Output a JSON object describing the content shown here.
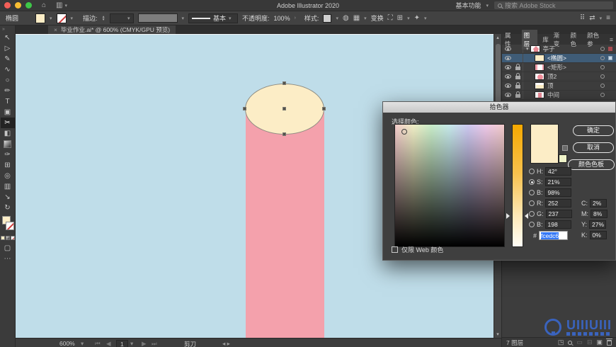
{
  "window": {
    "title": "Adobe Illustrator 2020",
    "workspace_switcher": "基本功能",
    "search_placeholder": "搜索 Adobe Stock"
  },
  "control_bar": {
    "context_label": "椭圆",
    "stroke_label": "描边:",
    "brush_label": "基本",
    "opacity_label": "不透明度:",
    "opacity_value": "100%",
    "style_label": "样式:",
    "transform_label": "变换"
  },
  "document_tab": {
    "close": "×",
    "title": "毕业作业.ai* @ 600% (CMYK/GPU 预览)"
  },
  "toolbar": {
    "tools": [
      {
        "name": "selection-tool",
        "glyph": "↖"
      },
      {
        "name": "direct-selection-tool",
        "glyph": "▷"
      },
      {
        "name": "pen-tool",
        "glyph": "✎"
      },
      {
        "name": "curvature-tool",
        "glyph": "∿"
      },
      {
        "name": "ellipse-tool",
        "glyph": "○"
      },
      {
        "name": "paintbrush-tool",
        "glyph": "✏"
      },
      {
        "name": "type-tool",
        "glyph": "T"
      },
      {
        "name": "artboard-tool",
        "glyph": "▣"
      },
      {
        "name": "scissors-tool",
        "glyph": "✂"
      },
      {
        "name": "shape-builder-tool",
        "glyph": "◧"
      },
      {
        "name": "eyedropper-tool",
        "glyph": "✑"
      },
      {
        "name": "symbol-tool",
        "glyph": "⊞"
      },
      {
        "name": "zoom-tool",
        "glyph": "◎"
      },
      {
        "name": "slice-tool",
        "glyph": "▥"
      },
      {
        "name": "hand-tool",
        "glyph": "↘"
      },
      {
        "name": "rotate-view-tool",
        "glyph": "↻"
      }
    ],
    "active_tool": "scissors-tool",
    "more": "⋯"
  },
  "canvas": {
    "background_color": "#bfdde9",
    "rect_fill": "#f4a1ac",
    "ellipse_fill": "#fcedc6",
    "ellipse_stroke": "#8d8b80"
  },
  "panel": {
    "tabs": [
      "属性",
      "图层",
      "库",
      "渐变",
      "颜色",
      "颜色参"
    ],
    "tabs_menu": "≡",
    "layers": [
      {
        "name": "亭子"
      },
      {
        "name": "<椭圆>"
      },
      {
        "name": "<矩形>"
      },
      {
        "name": "顶2"
      },
      {
        "name": "顶"
      },
      {
        "name": "中间"
      }
    ],
    "selected_layer": "<椭圆>",
    "footer_count": "7 图层"
  },
  "picker": {
    "title": "拾色器",
    "select_label": "选择颜色:",
    "ok": "确定",
    "cancel": "取消",
    "swatches": "颜色色板",
    "web_only_label": "仅限 Web 颜色",
    "fields": {
      "h_label": "H:",
      "h": "42°",
      "s_label": "S:",
      "s": "21%",
      "b_label": "B:",
      "b": "98%",
      "r_label": "R:",
      "r": "252",
      "g_label": "G:",
      "g": "237",
      "b2_label": "B:",
      "b2": "198",
      "hex_label": "#",
      "hex": "fcedc6",
      "c_label": "C:",
      "c": "2%",
      "m_label": "M:",
      "m": "8%",
      "y_label": "Y:",
      "y": "27%",
      "k_label": "K:",
      "k": "0%"
    },
    "selected_component": "S",
    "current_color": "#fcedc6"
  },
  "status_bar": {
    "zoom": "600%",
    "artboard_number": "1",
    "tool_name": "剪刀"
  },
  "watermark": {
    "text": "UIIIUIII"
  }
}
